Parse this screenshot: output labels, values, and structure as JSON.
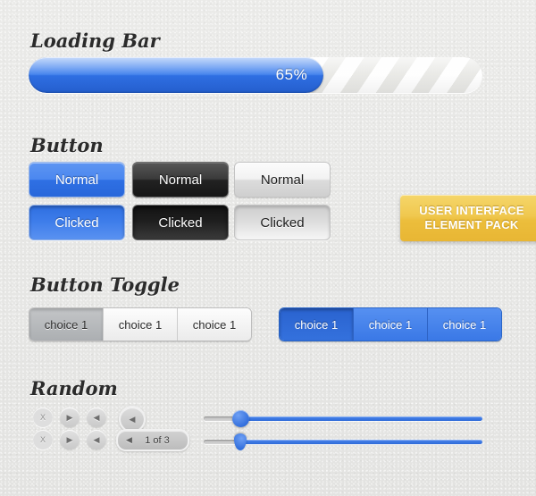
{
  "sections": {
    "loading": {
      "title": "Loading Bar"
    },
    "button": {
      "title": "Button"
    },
    "toggle": {
      "title": "Button Toggle"
    },
    "random": {
      "title": "Random"
    }
  },
  "progress": {
    "label": "65%",
    "value": 65,
    "fill_color": "#2f6fe3"
  },
  "buttons": {
    "normal_label": "Normal",
    "clicked_label": "Clicked"
  },
  "ribbon": {
    "line1": "USER INTERFACE",
    "line2": "ELEMENT PACK",
    "color": "#efc murky"
  },
  "toggle_gray": {
    "items": [
      {
        "label": "choice 1"
      },
      {
        "label": "choice 1"
      },
      {
        "label": "choice 1"
      }
    ]
  },
  "toggle_blue": {
    "items": [
      {
        "label": "choice 1"
      },
      {
        "label": "choice 1"
      },
      {
        "label": "choice 1"
      }
    ]
  },
  "random": {
    "icons": {
      "close": "X",
      "play": "▶",
      "prev": "◀"
    },
    "pager": {
      "arrow": "◀",
      "label": "1 of 3"
    }
  },
  "sliders": [
    {
      "name": "slider-round",
      "value": 13
    },
    {
      "name": "slider-pin",
      "value": 13
    }
  ]
}
